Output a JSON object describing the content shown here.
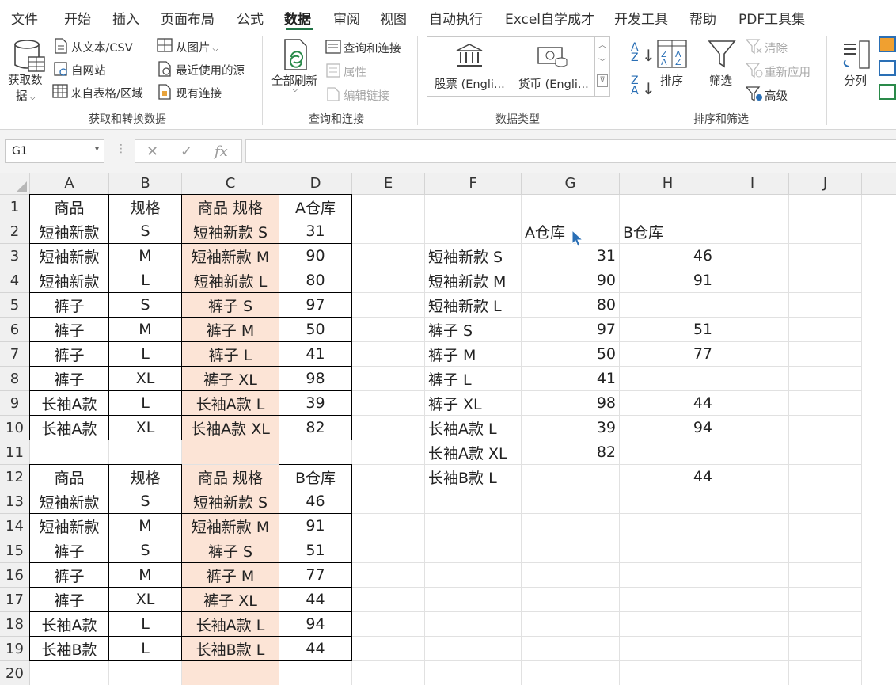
{
  "menu": {
    "tabs": [
      "文件",
      "开始",
      "插入",
      "页面布局",
      "公式",
      "数据",
      "审阅",
      "视图",
      "自动执行",
      "Excel自学成才",
      "开发工具",
      "帮助",
      "PDF工具集"
    ],
    "active": "数据"
  },
  "ribbon": {
    "get_data": {
      "label1": "获取数",
      "label2": "据",
      "from_text": "从文本/CSV",
      "from_web": "自网站",
      "from_table": "来自表格/区域",
      "from_picture": "从图片",
      "recent_sources": "最近使用的源",
      "existing_connections": "现有连接",
      "group": "获取和转换数据"
    },
    "queries": {
      "refresh_all": "全部刷新",
      "queries_connections": "查询和连接",
      "properties": "属性",
      "edit_links": "编辑链接",
      "group": "查询和连接"
    },
    "data_types": {
      "stocks": "股票 (Engli...",
      "currency": "货币 (Engli...",
      "group": "数据类型"
    },
    "sort_filter": {
      "sort": "排序",
      "filter": "筛选",
      "clear": "清除",
      "reapply": "重新应用",
      "advanced": "高级",
      "group": "排序和筛选"
    },
    "data_tools": {
      "split": "分列"
    }
  },
  "formula_bar": {
    "name_box": "G1",
    "formula": ""
  },
  "columns": [
    "A",
    "B",
    "C",
    "D",
    "E",
    "F",
    "G",
    "H",
    "I",
    "J"
  ],
  "rows": [
    "1",
    "2",
    "3",
    "4",
    "5",
    "6",
    "7",
    "8",
    "9",
    "10",
    "11",
    "12",
    "13",
    "14",
    "15",
    "16",
    "17",
    "18",
    "19",
    "20"
  ],
  "table_a": {
    "headers": [
      "商品",
      "规格",
      "商品 规格",
      "A仓库"
    ],
    "rows": [
      [
        "短袖新款",
        "S",
        "短袖新款 S",
        "31"
      ],
      [
        "短袖新款",
        "M",
        "短袖新款 M",
        "90"
      ],
      [
        "短袖新款",
        "L",
        "短袖新款 L",
        "80"
      ],
      [
        "裤子",
        "S",
        "裤子 S",
        "97"
      ],
      [
        "裤子",
        "M",
        "裤子 M",
        "50"
      ],
      [
        "裤子",
        "L",
        "裤子 L",
        "41"
      ],
      [
        "裤子",
        "XL",
        "裤子 XL",
        "98"
      ],
      [
        "长袖A款",
        "L",
        "长袖A款 L",
        "39"
      ],
      [
        "长袖A款",
        "XL",
        "长袖A款 XL",
        "82"
      ]
    ]
  },
  "table_b": {
    "headers": [
      "商品",
      "规格",
      "商品 规格",
      "B仓库"
    ],
    "rows": [
      [
        "短袖新款",
        "S",
        "短袖新款 S",
        "46"
      ],
      [
        "短袖新款",
        "M",
        "短袖新款 M",
        "91"
      ],
      [
        "裤子",
        "S",
        "裤子 S",
        "51"
      ],
      [
        "裤子",
        "M",
        "裤子 M",
        "77"
      ],
      [
        "裤子",
        "XL",
        "裤子 XL",
        "44"
      ],
      [
        "长袖A款",
        "L",
        "长袖A款 L",
        "94"
      ],
      [
        "长袖B款",
        "L",
        "长袖B款 L",
        "44"
      ]
    ]
  },
  "summary": {
    "headers": [
      "A仓库",
      "B仓库"
    ],
    "rows": [
      [
        "短袖新款 S",
        "31",
        "46"
      ],
      [
        "短袖新款 M",
        "90",
        "91"
      ],
      [
        "短袖新款 L",
        "80",
        ""
      ],
      [
        "裤子 S",
        "97",
        "51"
      ],
      [
        "裤子 M",
        "50",
        "77"
      ],
      [
        "裤子 L",
        "41",
        ""
      ],
      [
        "裤子 XL",
        "98",
        "44"
      ],
      [
        "长袖A款 L",
        "39",
        "94"
      ],
      [
        "长袖A款 XL",
        "82",
        ""
      ],
      [
        "长袖B款 L",
        "",
        "44"
      ]
    ]
  },
  "colors": {
    "accent": "#217346",
    "highlight": "#fce4d6"
  }
}
